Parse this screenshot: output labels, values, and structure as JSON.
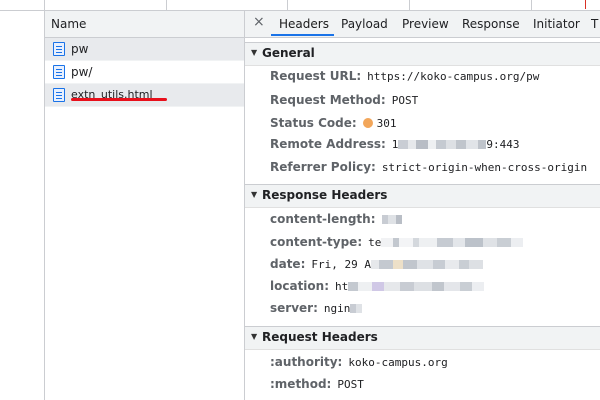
{
  "request_list": {
    "column_header": "Name",
    "items": [
      {
        "name": "pw",
        "selected": true
      },
      {
        "name": "pw/",
        "selected": false
      },
      {
        "name": "extn_utils.html",
        "selected": false,
        "redacted": true
      }
    ]
  },
  "detail_tabs": {
    "close_icon": "close-icon",
    "tabs": [
      "Headers",
      "Payload",
      "Preview",
      "Response",
      "Initiator",
      "T"
    ],
    "active": "Headers"
  },
  "general": {
    "title": "General",
    "request_url_key": "Request URL:",
    "request_url": "https://koko-campus.org/pw",
    "request_method_key": "Request Method:",
    "request_method": "POST",
    "status_code_key": "Status Code:",
    "status_code": "301",
    "status_color": "#f2a65a",
    "remote_address_key": "Remote Address:",
    "remote_address_prefix": "1",
    "remote_address_suffix": "9:443",
    "referrer_policy_key": "Referrer Policy:",
    "referrer_policy": "strict-origin-when-cross-origin"
  },
  "response_headers": {
    "title": "Response Headers",
    "content_length_key": "content-length:",
    "content_type_key": "content-type:",
    "content_type_prefix": "te",
    "date_key": "date:",
    "date_prefix": "Fri, 29 A",
    "location_key": "location:",
    "location_prefix": "ht",
    "server_key": "server:",
    "server_prefix": "ngin"
  },
  "request_headers": {
    "title": "Request Headers",
    "authority_key": ":authority:",
    "authority": "koko-campus.org",
    "method_key": ":method:",
    "method": "POST"
  },
  "colors": {
    "accent": "#1a73e8",
    "redaction_stroke": "#e8101b"
  }
}
